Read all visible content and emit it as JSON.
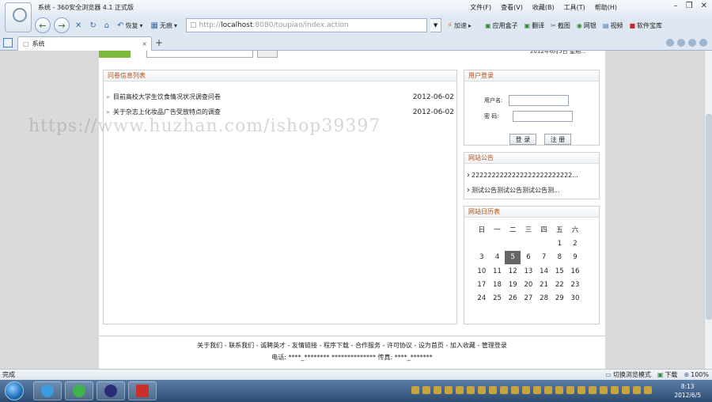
{
  "window": {
    "title": "系统 - 360安全浏览器 4.1 正式版",
    "menu": [
      "文件(F)",
      "查看(V)",
      "收藏(B)",
      "工具(T)",
      "帮助(H)"
    ]
  },
  "toolbar": {
    "restore_label": "恢复",
    "no_trace_label": "无痕",
    "address_prefix": "http://",
    "address_host": "localhost",
    "address_rest": ":8080/toupiao/index.action",
    "accelerate_label": "加速",
    "right_tools": [
      "应用盒子",
      "翻译",
      "截图",
      "网银",
      "视频",
      "软件宝库"
    ]
  },
  "tab": {
    "label": "系统"
  },
  "header": {
    "date_text": "2012年6月5日 星期..."
  },
  "left_panel": {
    "title": "问卷信息列表",
    "items": [
      {
        "title": "目前高校大学生饮食情况状况调查问卷",
        "date": "2012-06-02"
      },
      {
        "title": "关于杂志上化妆品广告受放特点的调查",
        "date": "2012-06-02"
      }
    ]
  },
  "login": {
    "title": "用户登录",
    "username_label": "用户名:",
    "password_label": "密 码:",
    "login_button": "登 录",
    "register_button": "注 册"
  },
  "site_notice": {
    "title": "网站公告",
    "items": [
      "2222222222222222222222222...",
      "测试公告测试公告测试公告测..."
    ]
  },
  "calendar": {
    "title": "网站日历表",
    "weekdays": [
      "日",
      "一",
      "二",
      "三",
      "四",
      "五",
      "六"
    ],
    "days": [
      [
        "",
        "",
        "",
        "",
        "",
        "1",
        "2"
      ],
      [
        "3",
        "4",
        "5",
        "6",
        "7",
        "8",
        "9"
      ],
      [
        "10",
        "11",
        "12",
        "13",
        "14",
        "15",
        "16"
      ],
      [
        "17",
        "18",
        "19",
        "20",
        "21",
        "22",
        "23"
      ],
      [
        "24",
        "25",
        "26",
        "27",
        "28",
        "29",
        "30"
      ]
    ],
    "today": "5"
  },
  "footer": {
    "links": "关于我们 - 联系我们 - 诚聘英才 - 友情链接 - 程序下载 - 合作服务 - 许可协议 - 设为首页 - 加入收藏 - 管理登录",
    "phone": "电话: ****_******** ************** 传真: ****_*******"
  },
  "status": {
    "left": "完成",
    "items": [
      "切换浏览模式",
      "下载",
      "100%"
    ]
  },
  "watermark": "https://www.huzhan.com/ishop39397",
  "clock": {
    "time": "8:13",
    "date": "2012/6/5"
  },
  "colors": {
    "accent": "#b34b12",
    "green": "#7cba3c",
    "taskbar": "#2c4b71"
  }
}
